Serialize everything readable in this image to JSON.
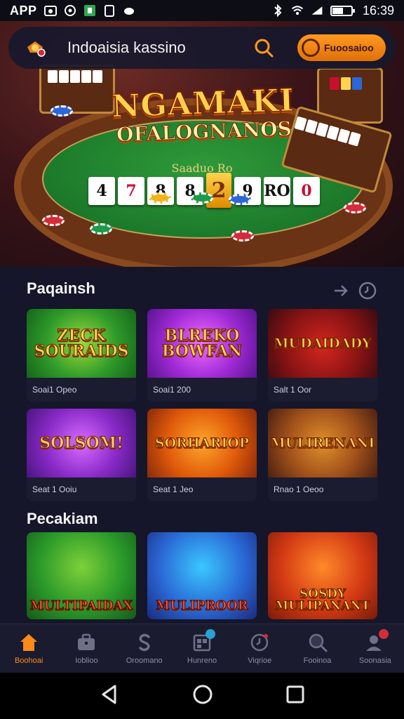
{
  "status_bar": {
    "app_label": "APP",
    "time": "16:39"
  },
  "topbar": {
    "title": "Indoaisia kassino",
    "promo_label": "Fuoosaioo"
  },
  "hero": {
    "title_line1": "NGAMAKI",
    "title_line2": "OFALOGNANOS",
    "table_label": "Saaduo Ro",
    "cards": [
      "4",
      "7",
      "8",
      "8",
      "2",
      "9",
      "RO",
      "0"
    ]
  },
  "sections": [
    {
      "title": "Paqainsh",
      "tiles": [
        {
          "art": "ZECK SOURAIDS",
          "caption": "Soai1 Opeo"
        },
        {
          "art": "BLREKO BOWFAN",
          "caption": "Soai1 200"
        },
        {
          "art": "MUDAIDADY",
          "caption": "Salt 1 Oor"
        },
        {
          "art": "SOLSOM!",
          "caption": "Seat 1 Ooiu"
        },
        {
          "art": "SORHARIOP",
          "caption": "Seat 1 Jeo"
        },
        {
          "art": "MULIRENANI",
          "caption": "Rnao 1 Oeoo"
        }
      ]
    },
    {
      "title": "Pecakiam",
      "tiles": [
        {
          "art": "MULTIPAIDAX"
        },
        {
          "art": "MULIPROOR"
        },
        {
          "art": "SOSDY MULIPANANT"
        }
      ]
    }
  ],
  "bottom_nav": [
    {
      "label": "Boohoai",
      "icon": "home-icon",
      "active": true
    },
    {
      "label": "Ioblioo",
      "icon": "briefcase-icon"
    },
    {
      "label": "Oroomano",
      "icon": "slots-icon"
    },
    {
      "label": "Hunreno",
      "icon": "calendar-icon",
      "badge": ""
    },
    {
      "label": "Viqrioe",
      "icon": "clock-icon"
    },
    {
      "label": "Fooinoa",
      "icon": "search-icon"
    },
    {
      "label": "Soonasia",
      "icon": "profile-icon",
      "badge": ""
    }
  ],
  "colors": {
    "accent": "#ff8a1a",
    "background": "#15162a",
    "nav_bg": "#1a1b2e"
  }
}
